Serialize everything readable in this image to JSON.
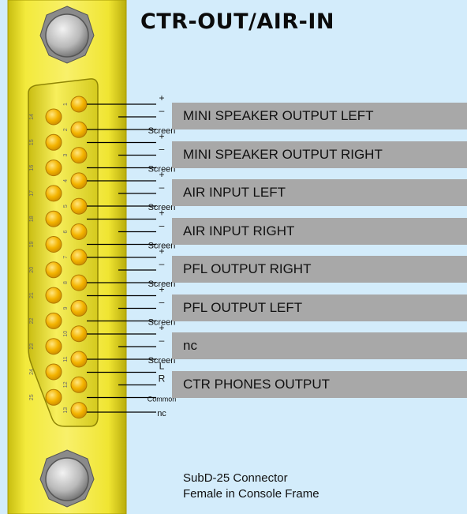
{
  "title": "CTR-OUT/AIR-IN",
  "pin_rows": {
    "top": [
      "1",
      "2",
      "3",
      "4",
      "5",
      "6",
      "7",
      "8",
      "9",
      "10",
      "11",
      "12",
      "13"
    ],
    "bottom": [
      "14",
      "15",
      "16",
      "17",
      "18",
      "19",
      "20",
      "21",
      "22",
      "23",
      "24",
      "25"
    ]
  },
  "signals": [
    {
      "name": "MINI SPEAKER OUTPUT LEFT",
      "wires": [
        "+",
        "–",
        "Screen"
      ]
    },
    {
      "name": "MINI SPEAKER OUTPUT RIGHT",
      "wires": [
        "+",
        "–",
        "Screen"
      ]
    },
    {
      "name": "AIR INPUT LEFT",
      "wires": [
        "+",
        "–",
        "Screen"
      ]
    },
    {
      "name": "AIR INPUT RIGHT",
      "wires": [
        "+",
        "–",
        "Screen"
      ]
    },
    {
      "name": "PFL OUTPUT RIGHT",
      "wires": [
        "+",
        "–",
        "Screen"
      ]
    },
    {
      "name": "PFL OUTPUT LEFT",
      "wires": [
        "+",
        "–",
        "Screen"
      ]
    },
    {
      "name": "nc",
      "wires": [
        "+",
        "–",
        "Screen"
      ]
    },
    {
      "name": "CTR PHONES OUTPUT",
      "wires": [
        "L",
        "R",
        "Common"
      ]
    }
  ],
  "last_pin_label": "nc",
  "connector_note": [
    "SubD-25 Connector",
    "Female in Console Frame"
  ],
  "colors": {
    "background": "#d3ecfb",
    "frame": "#f3e93a",
    "pin": "#f4b400",
    "bar": "#a8a8a8",
    "line": "#000000"
  }
}
